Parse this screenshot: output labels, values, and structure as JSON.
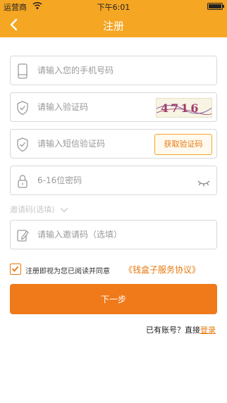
{
  "status": {
    "carrier": "运营商",
    "time": "下午6:01"
  },
  "nav": {
    "title": "注册"
  },
  "form": {
    "phone_placeholder": "请输入您的手机号码",
    "captcha_placeholder": "请输入验证码",
    "captcha_code": "4716",
    "sms_placeholder": "请输入短信验证码",
    "sms_button": "获取验证码",
    "password_placeholder": "6-16位密码",
    "invite_toggle": "邀请码(选填)",
    "invite_placeholder": "请输入邀请码（选填）"
  },
  "agreement": {
    "text": "注册即视为您已阅读并同意",
    "link": "《钱盒子服务协议》",
    "checked": true
  },
  "next_button": "下一步",
  "footer": {
    "prompt": "已有账号？直接",
    "login": "登录"
  },
  "colors": {
    "accent": "#f5a623",
    "button": "#f07a1a",
    "link": "#e8780c"
  },
  "icons": [
    "back-arrow-icon",
    "phone-icon",
    "shield-icon",
    "lock-icon",
    "eye-closed-icon",
    "chevron-down-icon",
    "edit-icon",
    "checkmark-icon",
    "wifi-icon",
    "battery-icon"
  ]
}
